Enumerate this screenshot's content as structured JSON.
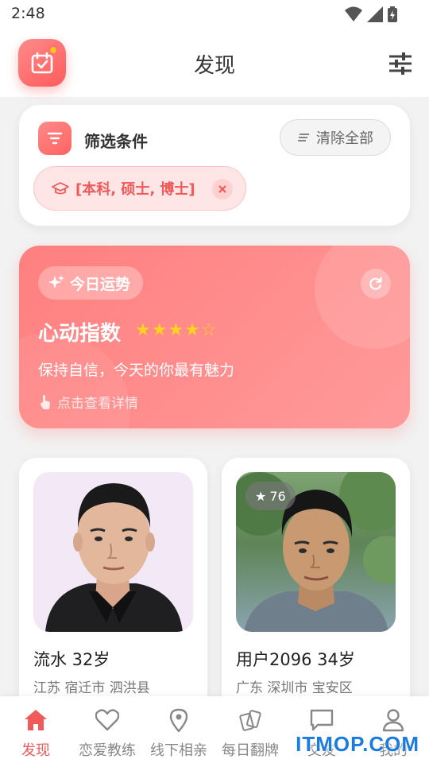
{
  "status_bar": {
    "time": "2:48"
  },
  "header": {
    "title": "发现"
  },
  "filter": {
    "title": "筛选条件",
    "clear_label": "清除全部",
    "chips": [
      {
        "label": "[本科, 硕士, 博士]"
      }
    ]
  },
  "fortune": {
    "tag": "今日运势",
    "title": "心动指数",
    "stars": "★★★★☆",
    "rating": 4,
    "message": "保持自信，今天的你最有魅力",
    "hint": "点击查看详情"
  },
  "profiles": [
    {
      "name": "流水 32岁",
      "location": "江苏 宿迁市 泗洪县"
    },
    {
      "name": "用户2096 34岁",
      "location": "广东 深圳市 宝安区",
      "score": "76"
    }
  ],
  "nav": {
    "items": [
      {
        "label": "发现",
        "icon": "home-icon",
        "active": true
      },
      {
        "label": "恋爱教练",
        "icon": "heart-icon"
      },
      {
        "label": "线下相亲",
        "icon": "location-pin-icon"
      },
      {
        "label": "每日翻牌",
        "icon": "cards-icon"
      },
      {
        "label": "交友",
        "icon": "chat-icon"
      },
      {
        "label": "我的",
        "icon": "person-icon"
      }
    ]
  },
  "watermark": "ITMOP.COM",
  "colors": {
    "accent": "#f05a5a",
    "star": "#ffd21f",
    "watermark": "#1a7be0"
  }
}
